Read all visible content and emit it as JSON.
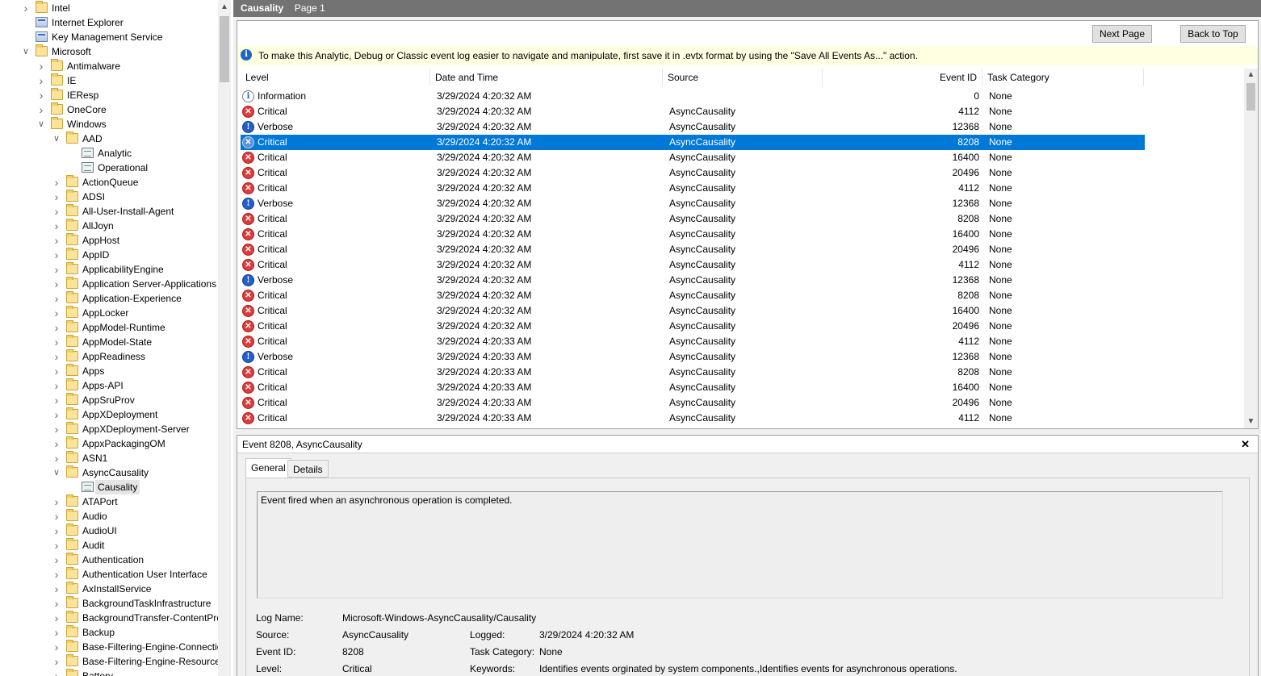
{
  "tree": {
    "items": [
      {
        "label": "Intel",
        "type": "folder",
        "level": 0,
        "expand": "collapsed"
      },
      {
        "label": "Internet Explorer",
        "type": "app",
        "level": 0,
        "expand": "none"
      },
      {
        "label": "Key Management Service",
        "type": "app",
        "level": 0,
        "expand": "none"
      },
      {
        "label": "Microsoft",
        "type": "folder",
        "level": 0,
        "expand": "expanded"
      },
      {
        "label": "Antimalware",
        "type": "folder",
        "level": 1,
        "expand": "collapsed"
      },
      {
        "label": "IE",
        "type": "folder",
        "level": 1,
        "expand": "collapsed"
      },
      {
        "label": "IEResp",
        "type": "folder",
        "level": 1,
        "expand": "collapsed"
      },
      {
        "label": "OneCore",
        "type": "folder",
        "level": 1,
        "expand": "collapsed"
      },
      {
        "label": "Windows",
        "type": "folder",
        "level": 1,
        "expand": "expanded"
      },
      {
        "label": "AAD",
        "type": "folder",
        "level": 2,
        "expand": "expanded"
      },
      {
        "label": "Analytic",
        "type": "log",
        "level": 3,
        "expand": "none"
      },
      {
        "label": "Operational",
        "type": "log",
        "level": 3,
        "expand": "none"
      },
      {
        "label": "ActionQueue",
        "type": "folder",
        "level": 2,
        "expand": "collapsed"
      },
      {
        "label": "ADSI",
        "type": "folder",
        "level": 2,
        "expand": "collapsed"
      },
      {
        "label": "All-User-Install-Agent",
        "type": "folder",
        "level": 2,
        "expand": "collapsed"
      },
      {
        "label": "AllJoyn",
        "type": "folder",
        "level": 2,
        "expand": "collapsed"
      },
      {
        "label": "AppHost",
        "type": "folder",
        "level": 2,
        "expand": "collapsed"
      },
      {
        "label": "AppID",
        "type": "folder",
        "level": 2,
        "expand": "collapsed"
      },
      {
        "label": "ApplicabilityEngine",
        "type": "folder",
        "level": 2,
        "expand": "collapsed"
      },
      {
        "label": "Application Server-Applications",
        "type": "folder",
        "level": 2,
        "expand": "collapsed"
      },
      {
        "label": "Application-Experience",
        "type": "folder",
        "level": 2,
        "expand": "collapsed"
      },
      {
        "label": "AppLocker",
        "type": "folder",
        "level": 2,
        "expand": "collapsed"
      },
      {
        "label": "AppModel-Runtime",
        "type": "folder",
        "level": 2,
        "expand": "collapsed"
      },
      {
        "label": "AppModel-State",
        "type": "folder",
        "level": 2,
        "expand": "collapsed"
      },
      {
        "label": "AppReadiness",
        "type": "folder",
        "level": 2,
        "expand": "collapsed"
      },
      {
        "label": "Apps",
        "type": "folder",
        "level": 2,
        "expand": "collapsed"
      },
      {
        "label": "Apps-API",
        "type": "folder",
        "level": 2,
        "expand": "collapsed"
      },
      {
        "label": "AppSruProv",
        "type": "folder",
        "level": 2,
        "expand": "collapsed"
      },
      {
        "label": "AppXDeployment",
        "type": "folder",
        "level": 2,
        "expand": "collapsed"
      },
      {
        "label": "AppXDeployment-Server",
        "type": "folder",
        "level": 2,
        "expand": "collapsed"
      },
      {
        "label": "AppxPackagingOM",
        "type": "folder",
        "level": 2,
        "expand": "collapsed"
      },
      {
        "label": "ASN1",
        "type": "folder",
        "level": 2,
        "expand": "collapsed"
      },
      {
        "label": "AsyncCausality",
        "type": "folder",
        "level": 2,
        "expand": "expanded"
      },
      {
        "label": "Causality",
        "type": "log",
        "level": 3,
        "expand": "none",
        "selected": true
      },
      {
        "label": "ATAPort",
        "type": "folder",
        "level": 2,
        "expand": "collapsed"
      },
      {
        "label": "Audio",
        "type": "folder",
        "level": 2,
        "expand": "collapsed"
      },
      {
        "label": "AudioUI",
        "type": "folder",
        "level": 2,
        "expand": "collapsed"
      },
      {
        "label": "Audit",
        "type": "folder",
        "level": 2,
        "expand": "collapsed"
      },
      {
        "label": "Authentication",
        "type": "folder",
        "level": 2,
        "expand": "collapsed"
      },
      {
        "label": "Authentication User Interface",
        "type": "folder",
        "level": 2,
        "expand": "collapsed"
      },
      {
        "label": "AxInstallService",
        "type": "folder",
        "level": 2,
        "expand": "collapsed"
      },
      {
        "label": "BackgroundTaskInfrastructure",
        "type": "folder",
        "level": 2,
        "expand": "collapsed"
      },
      {
        "label": "BackgroundTransfer-ContentPrefetcher",
        "type": "folder",
        "level": 2,
        "expand": "collapsed"
      },
      {
        "label": "Backup",
        "type": "folder",
        "level": 2,
        "expand": "collapsed"
      },
      {
        "label": "Base-Filtering-Engine-Connections",
        "type": "folder",
        "level": 2,
        "expand": "collapsed"
      },
      {
        "label": "Base-Filtering-Engine-Resource-Flows",
        "type": "folder",
        "level": 2,
        "expand": "collapsed"
      },
      {
        "label": "Battery",
        "type": "folder",
        "level": 2,
        "expand": "collapsed"
      }
    ]
  },
  "header": {
    "title": "Causality",
    "page": "Page 1"
  },
  "toolbar": {
    "next_page": "Next Page",
    "back_to_top": "Back to Top"
  },
  "infobar": {
    "message": "To make this Analytic, Debug or Classic event log easier to navigate and manipulate, first save it in .evtx format by using the \"Save All Events As...\" action."
  },
  "grid": {
    "columns": {
      "level": "Level",
      "datetime": "Date and Time",
      "source": "Source",
      "event_id": "Event ID",
      "task_category": "Task Category"
    },
    "rows": [
      {
        "level": "Information",
        "icon": "information-icon",
        "datetime": "3/29/2024 4:20:32 AM",
        "source": "",
        "event_id": "0",
        "task": "None"
      },
      {
        "level": "Critical",
        "icon": "critical-icon",
        "datetime": "3/29/2024 4:20:32 AM",
        "source": "AsyncCausality",
        "event_id": "4112",
        "task": "None"
      },
      {
        "level": "Verbose",
        "icon": "verbose-icon",
        "datetime": "3/29/2024 4:20:32 AM",
        "source": "AsyncCausality",
        "event_id": "12368",
        "task": "None"
      },
      {
        "level": "Critical",
        "icon": "critical-icon",
        "datetime": "3/29/2024 4:20:32 AM",
        "source": "AsyncCausality",
        "event_id": "8208",
        "task": "None",
        "selected": true
      },
      {
        "level": "Critical",
        "icon": "critical-icon",
        "datetime": "3/29/2024 4:20:32 AM",
        "source": "AsyncCausality",
        "event_id": "16400",
        "task": "None"
      },
      {
        "level": "Critical",
        "icon": "critical-icon",
        "datetime": "3/29/2024 4:20:32 AM",
        "source": "AsyncCausality",
        "event_id": "20496",
        "task": "None"
      },
      {
        "level": "Critical",
        "icon": "critical-icon",
        "datetime": "3/29/2024 4:20:32 AM",
        "source": "AsyncCausality",
        "event_id": "4112",
        "task": "None"
      },
      {
        "level": "Verbose",
        "icon": "verbose-icon",
        "datetime": "3/29/2024 4:20:32 AM",
        "source": "AsyncCausality",
        "event_id": "12368",
        "task": "None"
      },
      {
        "level": "Critical",
        "icon": "critical-icon",
        "datetime": "3/29/2024 4:20:32 AM",
        "source": "AsyncCausality",
        "event_id": "8208",
        "task": "None"
      },
      {
        "level": "Critical",
        "icon": "critical-icon",
        "datetime": "3/29/2024 4:20:32 AM",
        "source": "AsyncCausality",
        "event_id": "16400",
        "task": "None"
      },
      {
        "level": "Critical",
        "icon": "critical-icon",
        "datetime": "3/29/2024 4:20:32 AM",
        "source": "AsyncCausality",
        "event_id": "20496",
        "task": "None"
      },
      {
        "level": "Critical",
        "icon": "critical-icon",
        "datetime": "3/29/2024 4:20:32 AM",
        "source": "AsyncCausality",
        "event_id": "4112",
        "task": "None"
      },
      {
        "level": "Verbose",
        "icon": "verbose-icon",
        "datetime": "3/29/2024 4:20:32 AM",
        "source": "AsyncCausality",
        "event_id": "12368",
        "task": "None"
      },
      {
        "level": "Critical",
        "icon": "critical-icon",
        "datetime": "3/29/2024 4:20:32 AM",
        "source": "AsyncCausality",
        "event_id": "8208",
        "task": "None"
      },
      {
        "level": "Critical",
        "icon": "critical-icon",
        "datetime": "3/29/2024 4:20:32 AM",
        "source": "AsyncCausality",
        "event_id": "16400",
        "task": "None"
      },
      {
        "level": "Critical",
        "icon": "critical-icon",
        "datetime": "3/29/2024 4:20:32 AM",
        "source": "AsyncCausality",
        "event_id": "20496",
        "task": "None"
      },
      {
        "level": "Critical",
        "icon": "critical-icon",
        "datetime": "3/29/2024 4:20:33 AM",
        "source": "AsyncCausality",
        "event_id": "4112",
        "task": "None"
      },
      {
        "level": "Verbose",
        "icon": "verbose-icon",
        "datetime": "3/29/2024 4:20:33 AM",
        "source": "AsyncCausality",
        "event_id": "12368",
        "task": "None"
      },
      {
        "level": "Critical",
        "icon": "critical-icon",
        "datetime": "3/29/2024 4:20:33 AM",
        "source": "AsyncCausality",
        "event_id": "8208",
        "task": "None"
      },
      {
        "level": "Critical",
        "icon": "critical-icon",
        "datetime": "3/29/2024 4:20:33 AM",
        "source": "AsyncCausality",
        "event_id": "16400",
        "task": "None"
      },
      {
        "level": "Critical",
        "icon": "critical-icon",
        "datetime": "3/29/2024 4:20:33 AM",
        "source": "AsyncCausality",
        "event_id": "20496",
        "task": "None"
      },
      {
        "level": "Critical",
        "icon": "critical-icon",
        "datetime": "3/29/2024 4:20:33 AM",
        "source": "AsyncCausality",
        "event_id": "4112",
        "task": "None"
      }
    ]
  },
  "details": {
    "title": "Event 8208, AsyncCausality",
    "tabs": {
      "general": "General",
      "details": "Details"
    },
    "description": "Event fired when an asynchronous operation is completed.",
    "props": {
      "log_name_label": "Log Name:",
      "log_name": "Microsoft-Windows-AsyncCausality/Causality",
      "source_label": "Source:",
      "source": "AsyncCausality",
      "logged_label": "Logged:",
      "logged": "3/29/2024 4:20:32 AM",
      "event_id_label": "Event ID:",
      "event_id": "8208",
      "task_category_label": "Task Category:",
      "task_category": "None",
      "level_label": "Level:",
      "level": "Critical",
      "keywords_label": "Keywords:",
      "keywords": "Identifies events orginated by system components.,Identifies events for asynchronous operations."
    }
  },
  "colors": {
    "selection": "#0078d7",
    "titlebar": "#737373",
    "infobar": "#ffffe1",
    "critical": "#e03b3b",
    "verbose": "#2360c9"
  }
}
